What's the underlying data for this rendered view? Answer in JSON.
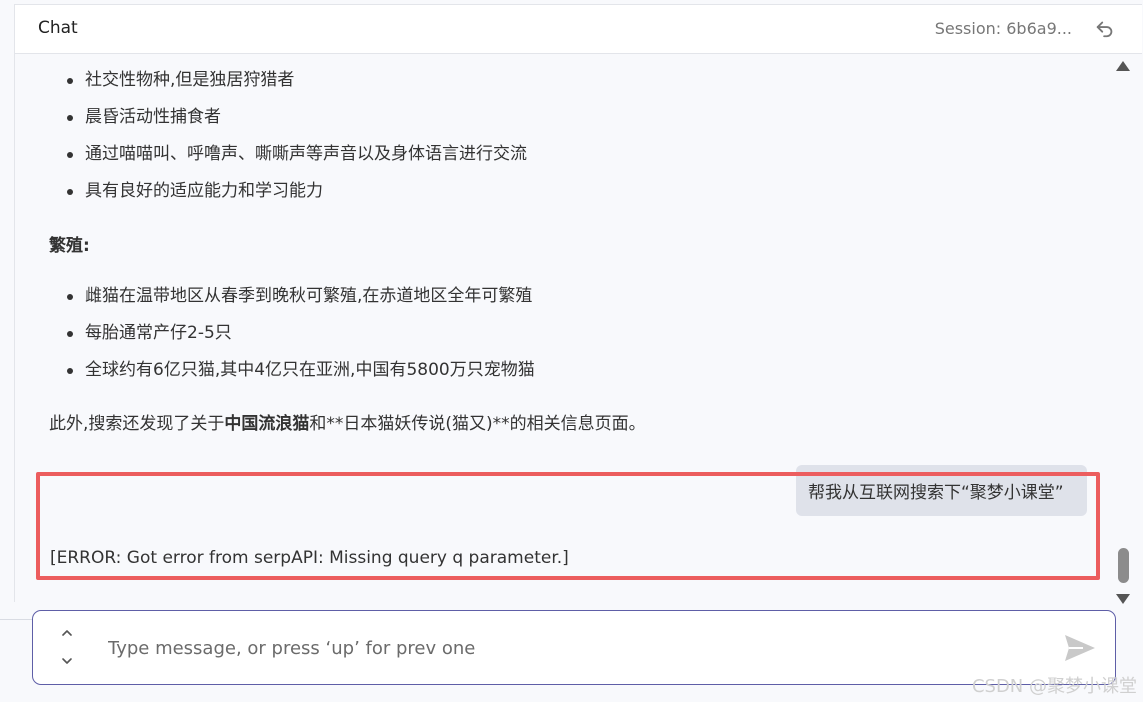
{
  "header": {
    "title": "Chat",
    "session": "Session: 6b6a9..."
  },
  "messages": {
    "bullets_top": [
      "社交性物种,但是独居狩猎者",
      "晨昏活动性捕食者",
      "通过喵喵叫、呼噜声、嘶嘶声等声音以及身体语言进行交流",
      "具有良好的适应能力和学习能力"
    ],
    "section_title": "繁殖:",
    "bullets_bottom": [
      "雌猫在温带地区从春季到晚秋可繁殖,在赤道地区全年可繁殖",
      "每胎通常产仔2-5只",
      "全球约有6亿只猫,其中4亿只在亚洲,中国有5800万只宠物猫"
    ],
    "paragraph": {
      "prefix": "此外,搜索还发现了关于",
      "bold": "中国流浪猫",
      "suffix": "和**日本猫妖传说(猫又)**的相关信息页面。"
    },
    "user_message": "帮我从互联网搜索下“聚梦小课堂”",
    "error_message": "[ERROR: Got error from serpAPI: Missing query  q  parameter.]"
  },
  "input": {
    "placeholder": "Type message, or press ‘up’ for prev one",
    "value": ""
  },
  "icons": {
    "undo": "undo-icon",
    "send": "send-icon",
    "history_up": "chevron-up-icon",
    "history_down": "chevron-down-icon"
  },
  "colors": {
    "highlight_border": "#ec5d5e",
    "input_border": "#5e5ea7",
    "user_bubble": "#dfe2ea"
  },
  "watermark": "CSDN @聚梦小课堂"
}
